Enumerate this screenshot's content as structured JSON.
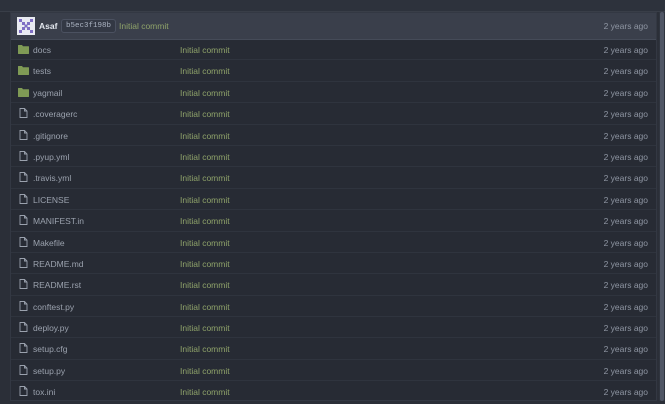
{
  "commit": {
    "author": "Asaf",
    "sha": "b5ec3f198b",
    "message": "Initial commit",
    "time": "2 years ago"
  },
  "files": [
    {
      "type": "folder",
      "icon": "folder-icon",
      "name": "docs",
      "message": "Initial commit",
      "time": "2 years ago"
    },
    {
      "type": "folder",
      "icon": "folder-icon",
      "name": "tests",
      "message": "Initial commit",
      "time": "2 years ago"
    },
    {
      "type": "folder",
      "icon": "folder-icon",
      "name": "yagmail",
      "message": "Initial commit",
      "time": "2 years ago"
    },
    {
      "type": "file",
      "icon": "file-icon",
      "name": ".coveragerc",
      "message": "Initial commit",
      "time": "2 years ago"
    },
    {
      "type": "file",
      "icon": "file-icon",
      "name": ".gitignore",
      "message": "Initial commit",
      "time": "2 years ago"
    },
    {
      "type": "file",
      "icon": "file-icon",
      "name": ".pyup.yml",
      "message": "Initial commit",
      "time": "2 years ago"
    },
    {
      "type": "file",
      "icon": "file-icon",
      "name": ".travis.yml",
      "message": "Initial commit",
      "time": "2 years ago"
    },
    {
      "type": "file",
      "icon": "file-icon",
      "name": "LICENSE",
      "message": "Initial commit",
      "time": "2 years ago"
    },
    {
      "type": "file",
      "icon": "file-icon",
      "name": "MANIFEST.in",
      "message": "Initial commit",
      "time": "2 years ago"
    },
    {
      "type": "file",
      "icon": "file-icon",
      "name": "Makefile",
      "message": "Initial commit",
      "time": "2 years ago"
    },
    {
      "type": "file",
      "icon": "file-icon",
      "name": "README.md",
      "message": "Initial commit",
      "time": "2 years ago"
    },
    {
      "type": "file",
      "icon": "file-icon",
      "name": "README.rst",
      "message": "Initial commit",
      "time": "2 years ago"
    },
    {
      "type": "file",
      "icon": "file-icon",
      "name": "conftest.py",
      "message": "Initial commit",
      "time": "2 years ago"
    },
    {
      "type": "file",
      "icon": "file-icon",
      "name": "deploy.py",
      "message": "Initial commit",
      "time": "2 years ago"
    },
    {
      "type": "file",
      "icon": "file-icon",
      "name": "setup.cfg",
      "message": "Initial commit",
      "time": "2 years ago"
    },
    {
      "type": "file",
      "icon": "file-icon",
      "name": "setup.py",
      "message": "Initial commit",
      "time": "2 years ago"
    },
    {
      "type": "file",
      "icon": "file-icon",
      "name": "tox.ini",
      "message": "Initial commit",
      "time": "2 years ago"
    }
  ],
  "colors": {
    "background": "#2b2f38",
    "header": "#3a3f4b",
    "commit_message": "#8fa36a",
    "folder": "#7f9a55",
    "file": "#9ba2ae"
  }
}
